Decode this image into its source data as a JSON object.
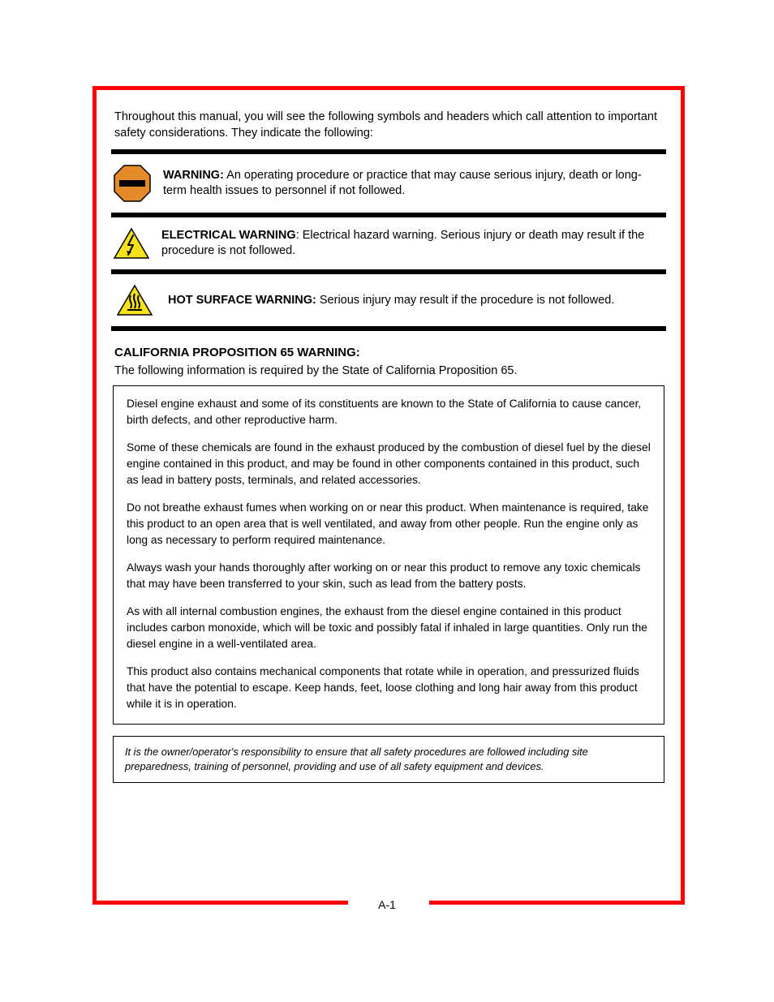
{
  "legend_intro": "Throughout this manual, you will see the following symbols and headers which call attention to important safety considerations.  They indicate the following:",
  "rows": [
    {
      "lead": "WARNING:",
      "text": " An operating procedure or practice that may cause serious injury, death or long-term health issues to personnel if not followed."
    },
    {
      "lead": "ELECTRICAL WARNING",
      "text": ": Electrical hazard warning.  Serious injury or death may result if the procedure is not followed."
    },
    {
      "lead": "HOT SURFACE WARNING:",
      "text": "  Serious injury may result if the procedure is not followed."
    }
  ],
  "section": {
    "title": "CALIFORNIA PROPOSITION 65 WARNING:",
    "sub": "The following information is required by the State of California Proposition 65."
  },
  "box": [
    "Diesel engine exhaust and some of its constituents are known to the State of California to cause cancer, birth defects, and other reproductive harm.",
    "Some of these chemicals are found in the exhaust produced by the combustion of diesel fuel by the diesel engine contained in this product, and may be found in other components contained in this product, such as lead in battery posts, terminals, and related accessories.",
    "Do not breathe exhaust fumes when working on or near this product. When maintenance is required, take this product to an open area that is well ventilated, and away from other people. Run the engine only as long as necessary to perform required maintenance.",
    "Always wash your hands thoroughly after working on or near this product to remove any toxic chemicals that may have been transferred to your skin, such as lead from the battery posts.",
    "As with all internal combustion engines, the exhaust from the diesel engine contained in this product includes carbon monoxide, which will be toxic and possibly fatal if inhaled in large quantities. Only run the diesel engine in a well-ventilated area.",
    "This product also contains mechanical components that rotate while in operation, and pressurized fluids that have the potential to escape. Keep hands, feet, loose clothing and long hair away from this product while it is in operation."
  ],
  "disclaimer": "It is the owner/operator's responsibility to ensure that all safety procedures are followed including site preparedness, training of personnel, providing and use of all safety equipment and devices.",
  "page_number": "A-1"
}
